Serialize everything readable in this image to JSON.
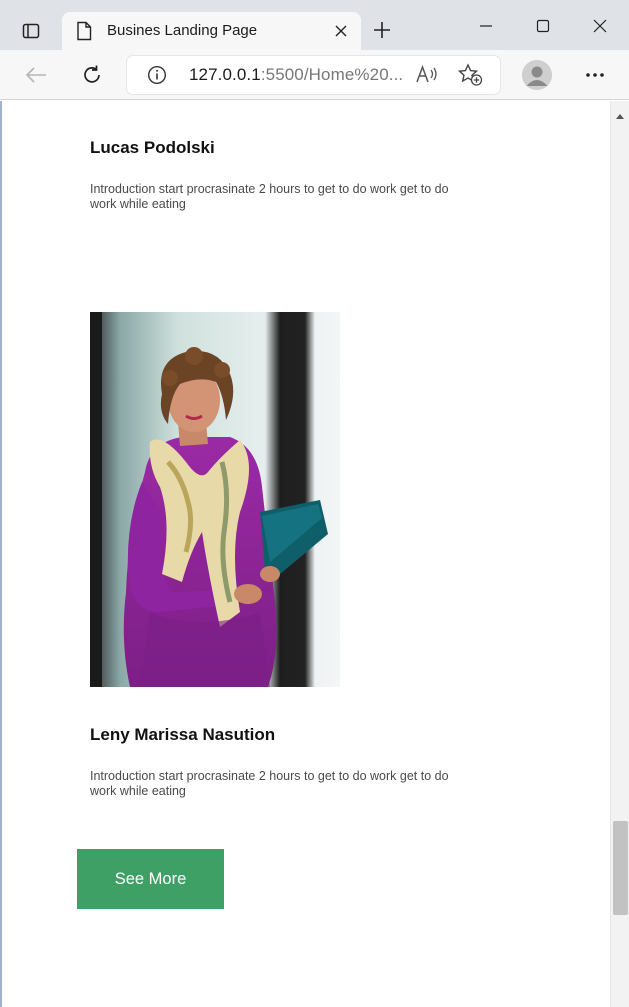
{
  "browser": {
    "tab": {
      "title": "Busines Landing Page",
      "icon": "page-icon"
    },
    "address": {
      "url_host": "127.0.0.1",
      "url_rest": ":5500/Home%20..."
    },
    "icons": {
      "tab_actions": "tab-actions-icon",
      "close": "close-icon",
      "new_tab": "plus-icon",
      "back": "back-arrow-icon",
      "refresh": "refresh-icon",
      "info": "info-icon",
      "read_aloud": "read-aloud-icon",
      "favorites": "add-favorite-icon",
      "profile": "profile-avatar-icon",
      "more": "more-icon",
      "minimize": "minimize-icon",
      "maximize": "maximize-icon",
      "window_close": "window-close-icon"
    }
  },
  "team": {
    "members": [
      {
        "name": "Lucas Podolski",
        "intro": "Introduction start procrasinate 2 hours to get to do work get to do work while eating"
      },
      {
        "name": "Leny Marissa Nasution",
        "intro": "Introduction start procrasinate 2 hours to get to do work get to do work while eating"
      }
    ],
    "see_more_label": "See More"
  },
  "colors": {
    "accent_button": "#3fa066",
    "tabbar": "#dfe3e8",
    "toolbar": "#f7f7f7"
  }
}
